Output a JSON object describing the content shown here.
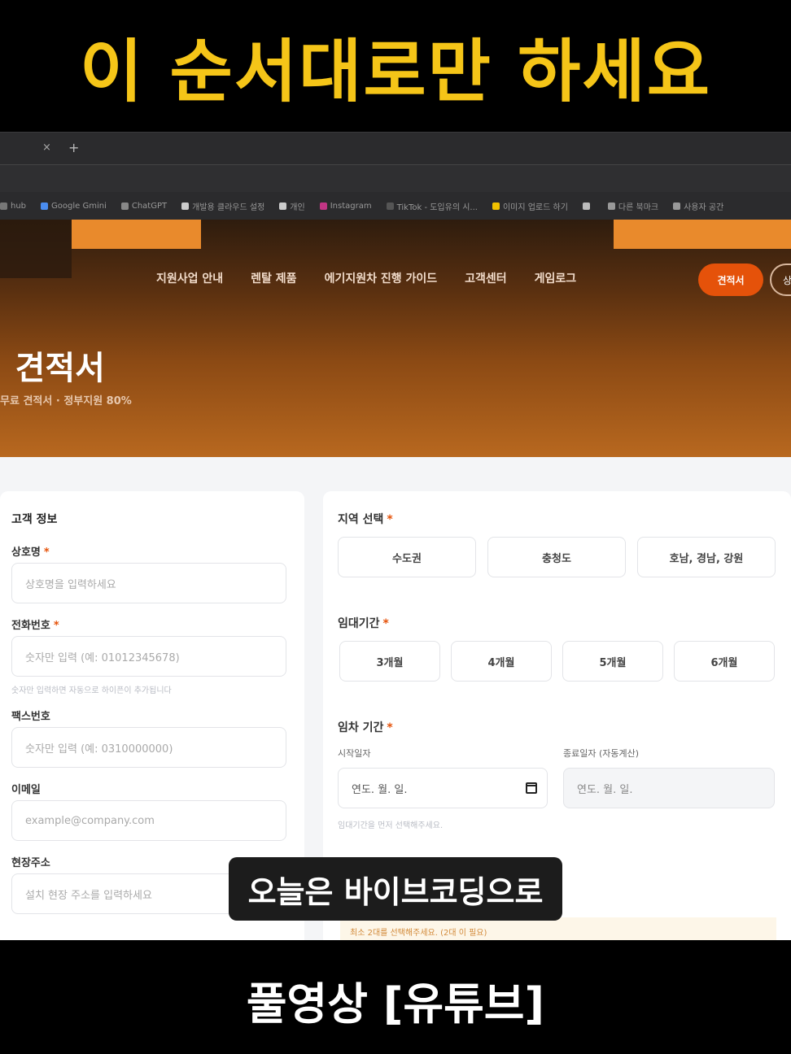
{
  "top_caption": "이 순서대로만 하세요",
  "browser": {
    "tab_close": "×",
    "tab_new": "+",
    "bookmarks": [
      {
        "label": "hub",
        "color": "#777"
      },
      {
        "label": "Google Gmini",
        "color": "#4a8df0"
      },
      {
        "label": "ChatGPT",
        "color": "#888"
      },
      {
        "label": "개발용 클라우드 설정",
        "color": "#ccc"
      },
      {
        "label": "개인",
        "color": "#ccc"
      },
      {
        "label": "Instagram",
        "color": "#c13584"
      },
      {
        "label": "TikTok - 도입유의 시...",
        "color": "#555"
      },
      {
        "label": "이미지 업로드 하기",
        "color": "#f2c200"
      },
      {
        "label": "",
        "color": "#bbb"
      },
      {
        "label": "다른 북마크",
        "color": "#999"
      },
      {
        "label": "사용자 공간",
        "color": "#999"
      }
    ]
  },
  "nav": {
    "items": [
      "지원사업 안내",
      "렌탈 제품",
      "에기지원차 진행 가이드",
      "고객센터",
      "게임로그"
    ],
    "quote_button": "견적서",
    "outline_button": "상"
  },
  "hero": {
    "title": "| 견적서",
    "subtitle": "무료 견적서 · 정부지원 80%"
  },
  "customer": {
    "section_title": "고객 정보",
    "company_label": "상호명",
    "company_placeholder": "상호명을 입력하세요",
    "phone_label": "전화번호",
    "phone_placeholder": "숫자만 입력 (예: 01012345678)",
    "phone_hint": "숫자만 입력하면 자동으로 하이픈이 추가됩니다",
    "fax_label": "팩스번호",
    "fax_placeholder": "숫자만 입력 (예: 0310000000)",
    "email_label": "이메일",
    "email_placeholder": "example@company.com",
    "address_label": "현장주소",
    "address_placeholder": "설치 현장 주소를 입력하세요"
  },
  "region": {
    "label": "지역 선택",
    "options": [
      "수도권",
      "충청도",
      "호남, 경남, 강원"
    ]
  },
  "period": {
    "label": "임대기간",
    "options": [
      "3개월",
      "4개월",
      "5개월",
      "6개월"
    ]
  },
  "dates": {
    "label": "임차 기간",
    "start_label": "시작일자",
    "end_label": "종료일자 (자동계산)",
    "start_placeholder": "연도. 월. 일.",
    "end_placeholder": "연도. 월. 일.",
    "hint": "임대기간을 먼저 선택해주세요."
  },
  "warning": "최소 2대를 선택해주세요. (2대 이 필요)",
  "subtitle_overlay": "오늘은 바이브코딩으로",
  "bottom_caption": "풀영상 [유튜브]",
  "colors": {
    "accent": "#e5520a",
    "caption_yellow": "#f5c518"
  }
}
